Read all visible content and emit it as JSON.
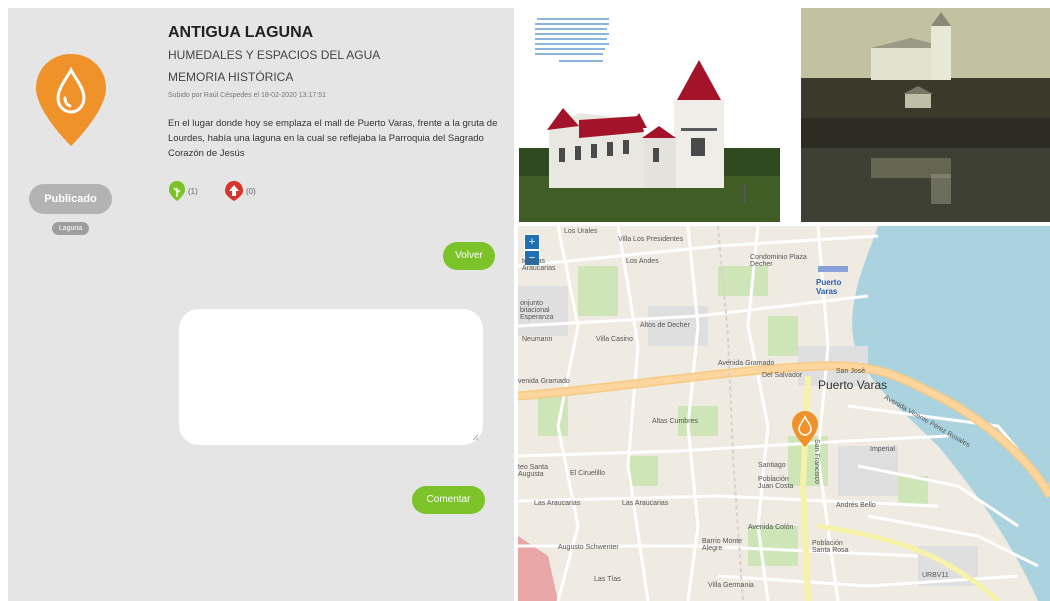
{
  "left": {
    "status": "Publicado",
    "category_tag": "Laguna",
    "title": "ANTIGUA LAGUNA",
    "subtitle1": "HUMEDALES Y ESPACIOS DEL AGUA",
    "subtitle2": "MEMORIA HISTÓRICA",
    "uploaded": "Subido por Raúl Céspedes el 18-02-2020 13:17:51",
    "description": "En el lugar donde hoy se emplaza el mall de Puerto Varas, frente a la gruta de Lourdes, había una laguna en la cual se reflejaba la Parroquia del Sagrado Corazón de Jesús",
    "likes": "(1)",
    "dislikes": "(0)",
    "back_button": "Volver",
    "comment_button": "Comentar",
    "comment_value": "",
    "pin_color": "#f0922a",
    "accent_green": "#7cc32a"
  },
  "map": {
    "zoom_in": "+",
    "zoom_out": "−",
    "labels": [
      "Los Urales",
      "Villa Los Presidentes",
      "teo Las Araucarias",
      "Los Andes",
      "Condominio Plaza Decher",
      "Puerto Varas",
      "Altos de Decher",
      "onjunto bitacional Esperanza",
      "Neumann",
      "Villa Casino",
      "venida Gramado",
      "Avenida Gramado",
      "San José",
      "Del Salvador",
      "Puerto Varas",
      "Altas Cumbres",
      "teo Santa Augusta",
      "El Ciruelillo",
      "Las Araucarias",
      "Las Araucarias",
      "Población Juan Costa",
      "Avenida Colón",
      "Barrio Monte Alegre",
      "Población Santa Rosa",
      "Augusto Schwenter",
      "Villa Germania",
      "Las Tías",
      "URBV11",
      "Avenida Vicente Pérez Rosales",
      "Santiago",
      "San Francisco",
      "Andrés Bello",
      "Imperial"
    ]
  }
}
